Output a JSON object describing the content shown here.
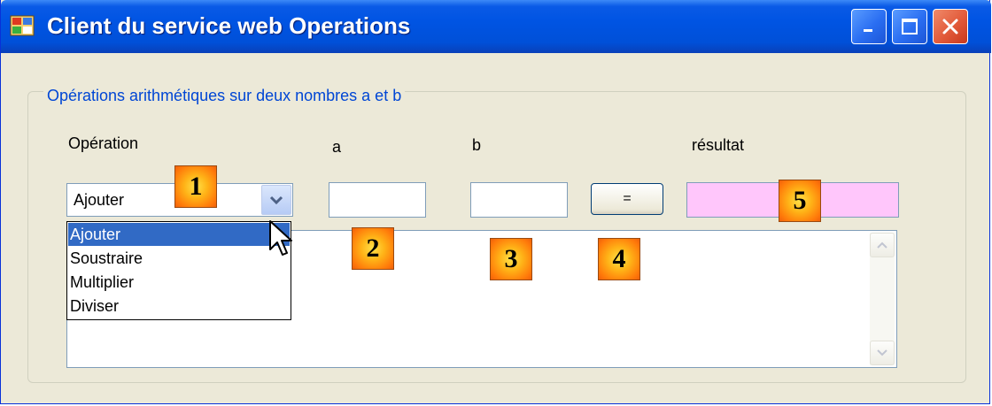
{
  "window": {
    "title": "Client du service web Operations",
    "titlebar_color": "#0054e3",
    "controls": [
      "minimize-icon",
      "maximize-icon",
      "close-icon"
    ]
  },
  "group": {
    "legend": "Opérations arithmétiques sur deux nombres a et b"
  },
  "labels": {
    "operation": "Opération",
    "a": "a",
    "b": "b",
    "result": "résultat"
  },
  "operation_combo": {
    "selected": "Ajouter",
    "options": [
      "Ajouter",
      "Soustraire",
      "Multiplier",
      "Diviser"
    ],
    "highlighted_index": 0,
    "open": true
  },
  "inputs": {
    "a_value": "",
    "b_value": "",
    "result_value": "",
    "result_background": "#ffc6fb"
  },
  "equals_button": {
    "label": "="
  },
  "callouts": [
    "1",
    "2",
    "3",
    "4",
    "5"
  ],
  "colors": {
    "selection": "#316ac5",
    "legend_text": "#0046d5",
    "callout_fill": "#ffb317"
  }
}
